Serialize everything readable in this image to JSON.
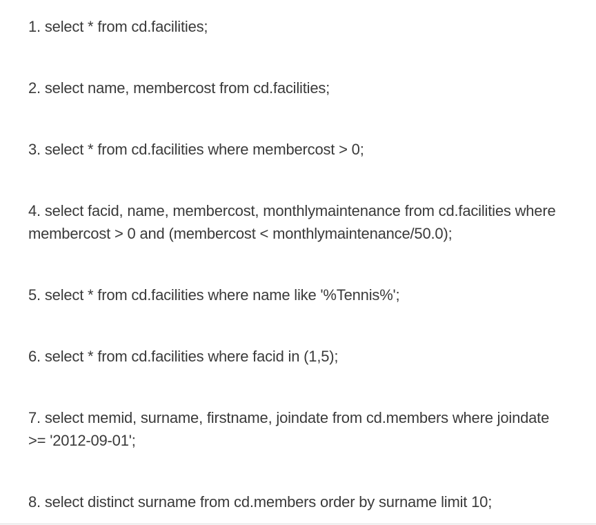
{
  "queries": [
    "1. select * from cd.facilities;",
    "2. select name, membercost from cd.facilities;",
    "3. select * from cd.facilities where membercost > 0;",
    "4. select facid, name, membercost, monthlymaintenance from cd.facilities where membercost > 0 and (membercost < monthlymaintenance/50.0);",
    "5. select * from cd.facilities where name like '%Tennis%';",
    "6. select * from cd.facilities where facid in (1,5);",
    "7. select memid, surname, firstname, joindate from cd.members where joindate >= '2012-09-01';",
    "8. select distinct surname from cd.members order by surname limit 10;"
  ]
}
